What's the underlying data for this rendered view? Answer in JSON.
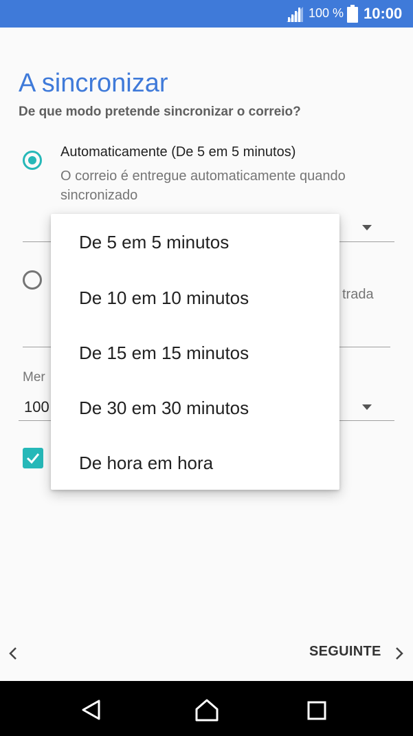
{
  "status_bar": {
    "battery_percent": "100 %",
    "time": "10:00"
  },
  "page": {
    "title": "A sincronizar",
    "subtitle": "De que modo pretende sincronizar o correio?"
  },
  "sync_options": [
    {
      "label": "Automaticamente (De 5 em 5 minutos)",
      "description": "O correio é entregue automaticamente quando sincronizado",
      "selected": true
    },
    {
      "partial_visible_text": "trada",
      "selected": false
    }
  ],
  "messages_field": {
    "label_partial": "Mer",
    "value_partial": "100"
  },
  "checkbox": {
    "checked": true
  },
  "dropdown": {
    "options": [
      "De 5 em 5 minutos",
      "De 10 em 10 minutos",
      "De 15 em 15 minutos",
      "De 30 em 30 minutos",
      "De hora em hora"
    ]
  },
  "footer": {
    "next_label": "SEGUINTE"
  },
  "colors": {
    "accent": "#3f7ad9",
    "teal": "#26b8b8",
    "status_bar": "#3f7ad9",
    "nav_bar": "#000000"
  },
  "icons": {
    "signal": "signal-icon",
    "battery": "battery-icon",
    "back": "chevron-left-icon",
    "next": "chevron-right-icon",
    "nav_back": "nav-back-icon",
    "nav_home": "nav-home-icon",
    "nav_recents": "nav-recents-icon"
  }
}
